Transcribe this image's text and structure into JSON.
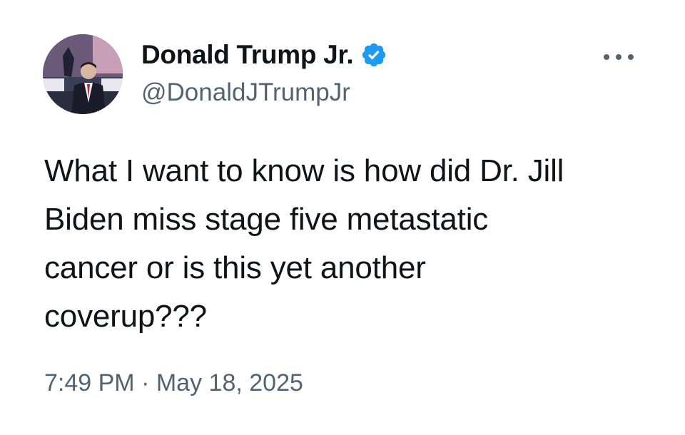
{
  "author": {
    "display_name": "Donald Trump Jr.",
    "handle": "@DonaldJTrumpJr",
    "verified_icon": "verified-badge-icon",
    "verified_color": "#1d9bf0",
    "avatar": "profile-photo"
  },
  "menu": {
    "icon": "more-options-icon"
  },
  "tweet": {
    "lines": [
      "What I want to know is how did Dr. Jill",
      "Biden miss stage five metastatic",
      "cancer or is this yet another",
      "coverup???"
    ]
  },
  "meta": {
    "time": "7:49 PM",
    "separator": "·",
    "date": "May 18, 2025"
  },
  "colors": {
    "text_primary": "#0f1419",
    "text_secondary": "#536471",
    "accent": "#1d9bf0",
    "background": "#ffffff"
  }
}
